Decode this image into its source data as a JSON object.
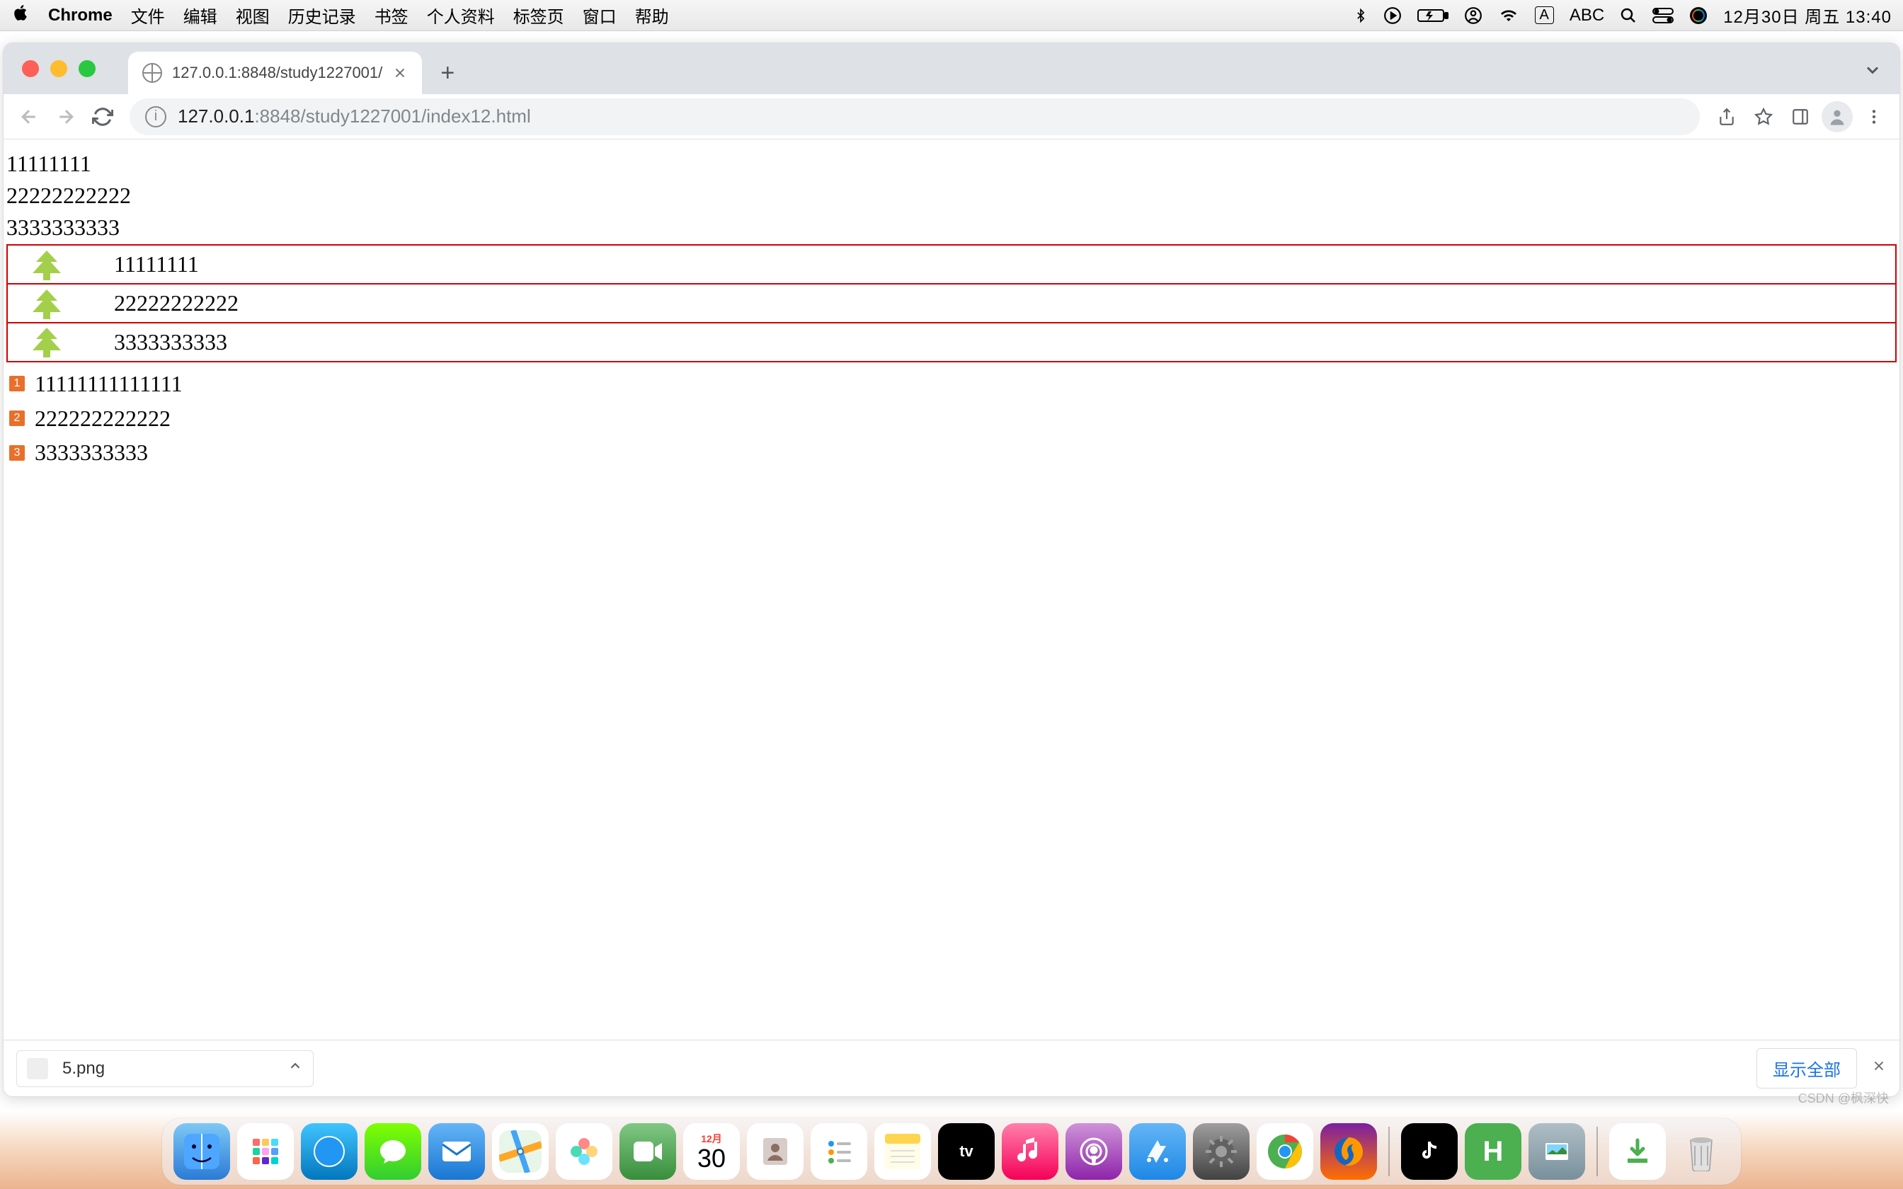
{
  "menubar": {
    "app": "Chrome",
    "items": [
      "文件",
      "编辑",
      "视图",
      "历史记录",
      "书签",
      "个人资料",
      "标签页",
      "窗口",
      "帮助"
    ],
    "input_indicator": "A",
    "input_label": "ABC",
    "clock": "12月30日 周五  13:40"
  },
  "chrome": {
    "tab_title": "127.0.0.1:8848/study1227001/",
    "url_start": "127.0.0.1",
    "url_rest": ":8848/study1227001/index12.html"
  },
  "page": {
    "plain": [
      "11111111",
      "22222222222",
      "3333333333"
    ],
    "tree": [
      "11111111",
      "22222222222",
      "3333333333"
    ],
    "numbered": [
      {
        "n": "1",
        "text": "11111111111111"
      },
      {
        "n": "2",
        "text": "222222222222"
      },
      {
        "n": "3",
        "text": "3333333333"
      }
    ]
  },
  "download": {
    "filename": "5.png",
    "show_all": "显示全部"
  },
  "dock": {
    "calendar_month": "12月",
    "calendar_day": "30"
  },
  "watermark": "CSDN @枫深快"
}
